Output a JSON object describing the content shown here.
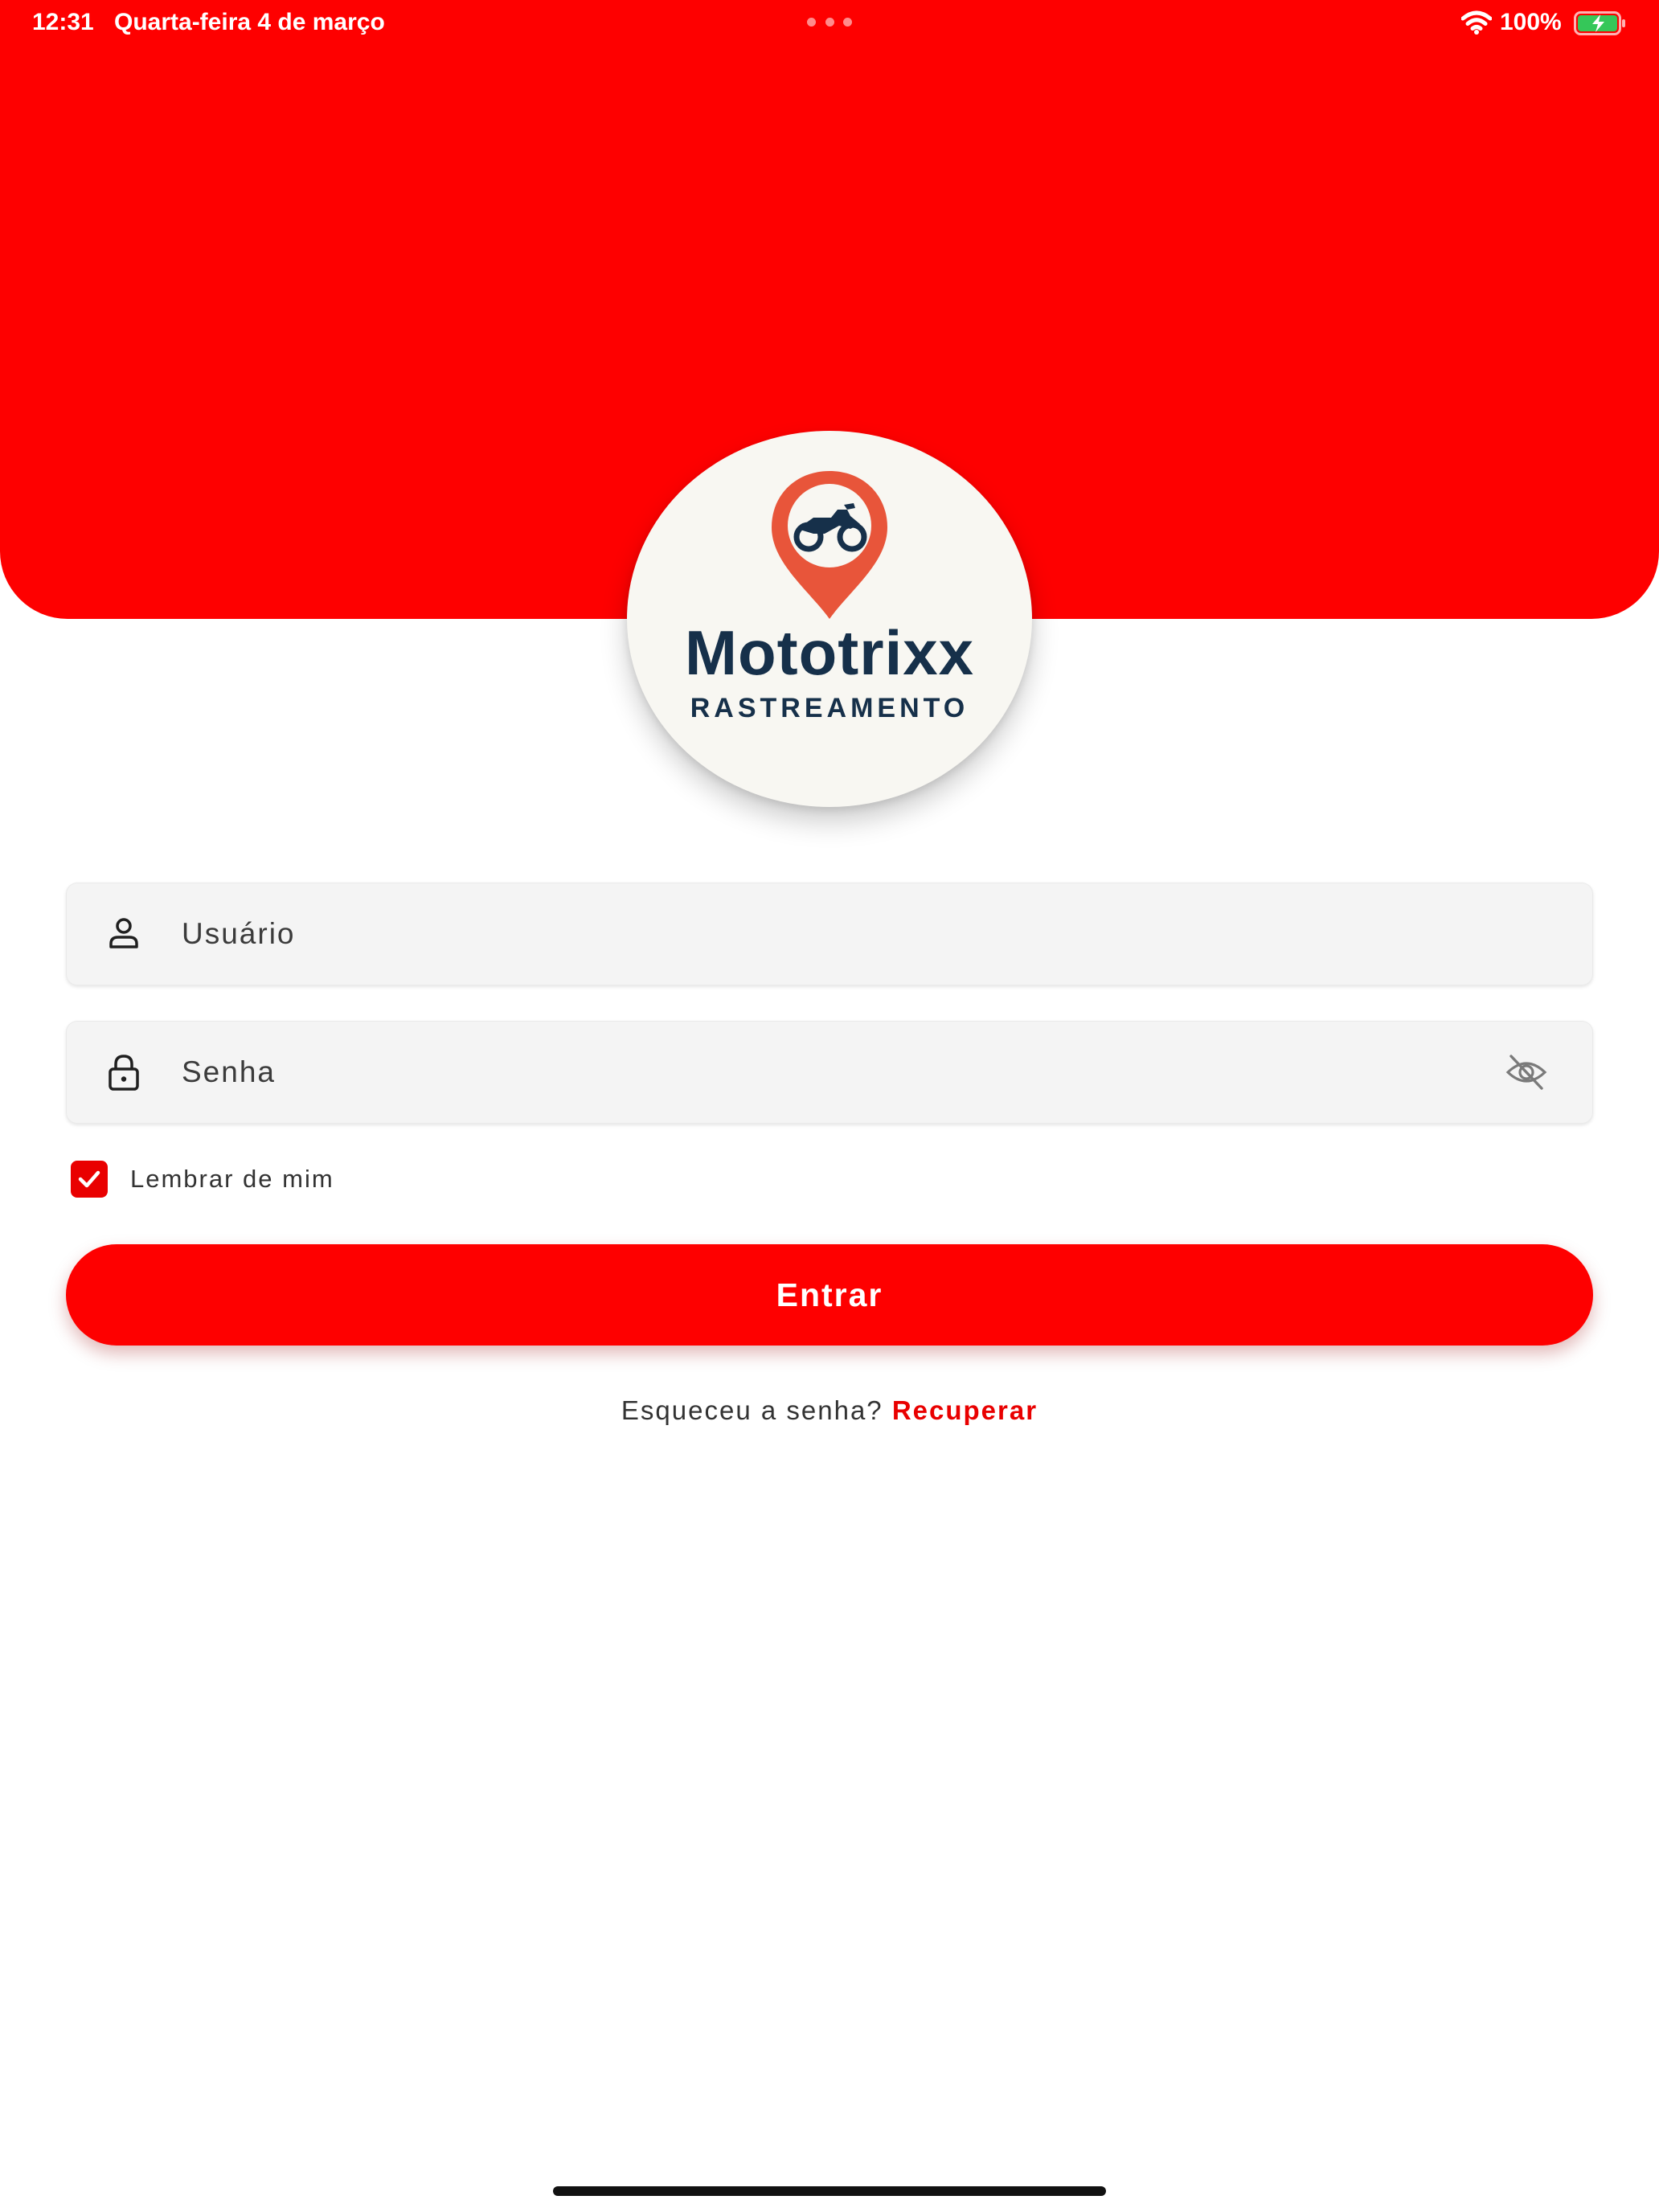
{
  "status_bar": {
    "time": "12:31",
    "date": "Quarta-feira 4 de março",
    "battery": "100%"
  },
  "logo": {
    "name": "Mototrixx",
    "tagline": "RASTREAMENTO"
  },
  "form": {
    "username_placeholder": "Usuário",
    "username_value": "",
    "password_placeholder": "Senha",
    "password_value": "",
    "remember_label": "Lembrar de mim",
    "remember_checked": true,
    "submit_label": "Entrar",
    "forgot_text": "Esqueceu a senha?",
    "forgot_link": "Recuperar"
  },
  "icons": {
    "username": "user-icon",
    "password": "lock-icon",
    "toggle_visibility": "eye-off-icon",
    "logo": "map-pin-motorcycle-icon"
  },
  "colors": {
    "brand_red": "#fe0000",
    "logo_navy": "#16304a",
    "pin_orange": "#e8553a"
  }
}
